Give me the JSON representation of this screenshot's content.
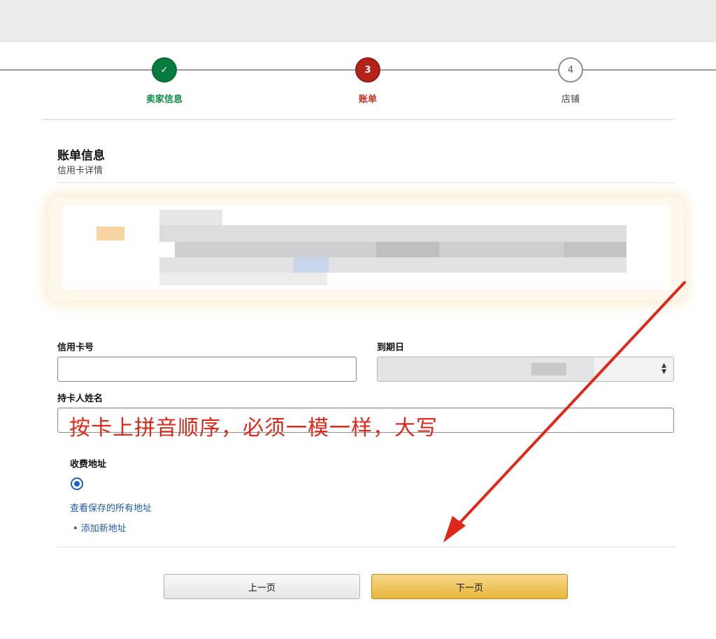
{
  "stepper": {
    "steps": [
      {
        "label": "卖家信息",
        "marker": "✓",
        "state": "done"
      },
      {
        "label": "账单",
        "marker": "3",
        "state": "active"
      },
      {
        "label": "店铺",
        "marker": "4",
        "state": "todo"
      }
    ]
  },
  "billing": {
    "title": "账单信息",
    "subtitle": "信用卡详情"
  },
  "form": {
    "card_number_label": "信用卡号",
    "card_number_value": "",
    "expiry_label": "到期日",
    "holder_name_label": "持卡人姓名",
    "holder_name_value": ""
  },
  "annotation": {
    "text": "按卡上拼音顺序，必须一模一样，大写",
    "color": "#e0281a"
  },
  "address": {
    "title": "收费地址",
    "view_all_link": "查看保存的所有地址",
    "add_new_link": "• 添加新地址"
  },
  "buttons": {
    "prev": "上一页",
    "next": "下一页"
  },
  "colors": {
    "done": "#067d3e",
    "active": "#b3231b",
    "link": "#1f5aa8",
    "primary_button": "#e8b73a"
  }
}
